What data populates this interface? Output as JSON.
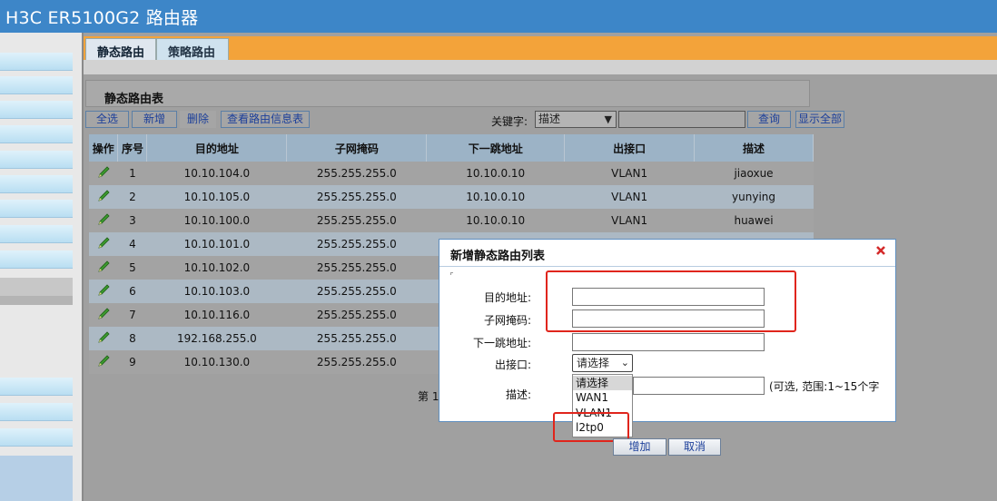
{
  "app": {
    "title": "H3C ER5100G2 路由器"
  },
  "tabs": [
    {
      "label": "静态路由"
    },
    {
      "label": "策略路由"
    }
  ],
  "panel": {
    "title": "静态路由表"
  },
  "toolbar": {
    "select_all": "全选",
    "add_new": "新增",
    "delete": "删除",
    "view_info": "查看路由信息表",
    "keyword_label": "关键字:",
    "keyword_selected": "描述",
    "search": "查询",
    "show_all": "显示全部"
  },
  "table": {
    "columns": [
      "操作",
      "序号",
      "目的地址",
      "子网掩码",
      "下一跳地址",
      "出接口",
      "描述"
    ],
    "rows": [
      {
        "no": "1",
        "dest": "10.10.104.0",
        "mask": "255.255.255.0",
        "next_hop": "10.10.0.10",
        "iface": "VLAN1",
        "desc": "jiaoxue"
      },
      {
        "no": "2",
        "dest": "10.10.105.0",
        "mask": "255.255.255.0",
        "next_hop": "10.10.0.10",
        "iface": "VLAN1",
        "desc": "yunying"
      },
      {
        "no": "3",
        "dest": "10.10.100.0",
        "mask": "255.255.255.0",
        "next_hop": "10.10.0.10",
        "iface": "VLAN1",
        "desc": "huawei"
      },
      {
        "no": "4",
        "dest": "10.10.101.0",
        "mask": "255.255.255.0"
      },
      {
        "no": "5",
        "dest": "10.10.102.0",
        "mask": "255.255.255.0"
      },
      {
        "no": "6",
        "dest": "10.10.103.0",
        "mask": "255.255.255.0"
      },
      {
        "no": "7",
        "dest": "10.10.116.0",
        "mask": "255.255.255.0"
      },
      {
        "no": "8",
        "dest": "192.168.255.0",
        "mask": "255.255.255.0"
      },
      {
        "no": "9",
        "dest": "10.10.130.0",
        "mask": "255.255.255.0"
      }
    ]
  },
  "pager": {
    "text": "第 1"
  },
  "modal": {
    "title": "新增静态路由列表",
    "dest_label": "目的地址:",
    "mask_label": "子网掩码:",
    "next_hop_label": "下一跳地址:",
    "iface_label": "出接口:",
    "desc_label": "描述:",
    "desc_hint": "(可选, 范围:1~15个字",
    "iface_selected": "请选择",
    "iface_options": [
      "请选择",
      "WAN1",
      "VLAN1",
      "l2tp0"
    ],
    "add_button": "增加",
    "cancel_button": "取消"
  },
  "colors": {
    "highlight": "#e0251c",
    "titlebar": "#3d86c8",
    "tabstrip": "#f3a33a"
  },
  "icons": {
    "edit": "pencil-icon",
    "close": "close-icon"
  }
}
